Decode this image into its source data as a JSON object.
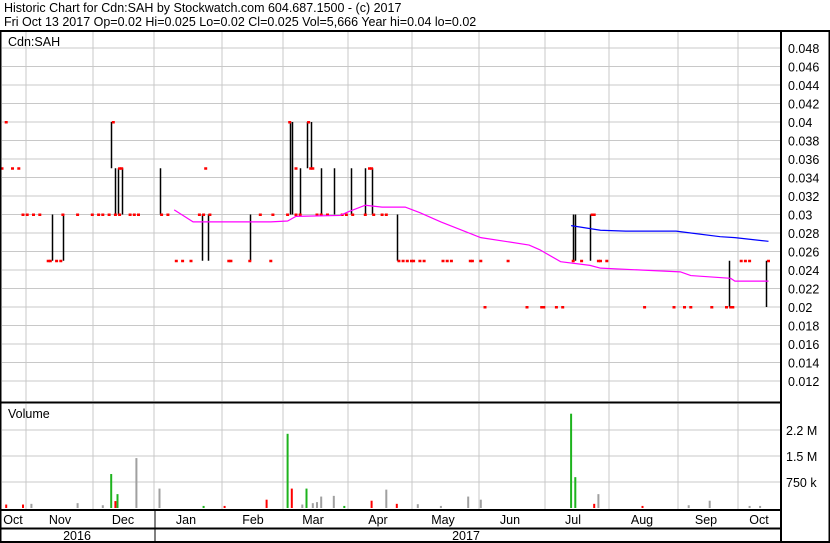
{
  "header": {
    "title": "Historic Chart for Cdn:SAH by Stockwatch.com 604.687.1500 - (c) 2017",
    "quote": "Fri Oct 13 2017  Op=0.02  Hi=0.025  Lo=0.02  Cl=0.025  Vol=5,666  Year hi=0.04  lo=0.02"
  },
  "colors": {
    "up": "#1db31d",
    "down": "#ff0000",
    "neutral": "#a0a0a0",
    "ma_short": "#ff00ff",
    "ma_long": "#0000ff",
    "tick": "#ff0000",
    "bar": "#000000"
  },
  "chart_data": {
    "type": "ohlc",
    "title": "Cdn:SAH",
    "x_unit": "days since 2016-10-20",
    "xlim": [
      0,
      370
    ],
    "ylim": [
      0.0101,
      0.0497
    ],
    "grid": true,
    "y_ticks": [
      "0.048",
      "0.046",
      "0.044",
      "0.042",
      "0.04",
      "0.038",
      "0.036",
      "0.034",
      "0.032",
      "0.03",
      "0.028",
      "0.026",
      "0.024",
      "0.022",
      "0.02",
      "0.018",
      "0.016",
      "0.014",
      "0.012"
    ],
    "month_labels": [
      "Oct",
      "Nov",
      "Dec",
      "Jan",
      "Feb",
      "Mar",
      "Apr",
      "May",
      "Jun",
      "Jul",
      "Aug",
      "Sep",
      "Oct"
    ],
    "year_labels": [
      "2016",
      "2017"
    ],
    "price_bars": [
      [
        24,
        0.025,
        0.03
      ],
      [
        29,
        0.025,
        0.03
      ],
      [
        52,
        0.035,
        0.04
      ],
      [
        54,
        0.03,
        0.035
      ],
      [
        55,
        0.03,
        0.035
      ],
      [
        57,
        0.03,
        0.035
      ],
      [
        75,
        0.03,
        0.035
      ],
      [
        95,
        0.025,
        0.03
      ],
      [
        98,
        0.025,
        0.03
      ],
      [
        118,
        0.025,
        0.03
      ],
      [
        137,
        0.03,
        0.04
      ],
      [
        138,
        0.03,
        0.04
      ],
      [
        142,
        0.03,
        0.035
      ],
      [
        145,
        0.035,
        0.04
      ],
      [
        147,
        0.035,
        0.04
      ],
      [
        152,
        0.03,
        0.035
      ],
      [
        158,
        0.03,
        0.035
      ],
      [
        166,
        0.03,
        0.035
      ],
      [
        173,
        0.03,
        0.035
      ],
      [
        176,
        0.03,
        0.035
      ],
      [
        188,
        0.025,
        0.03
      ],
      [
        272,
        0.025,
        0.03
      ],
      [
        273,
        0.025,
        0.03
      ],
      [
        280,
        0.025,
        0.03
      ],
      [
        346,
        0.02,
        0.025
      ],
      [
        364,
        0.02,
        0.025
      ]
    ],
    "close_ticks": [
      [
        2,
        0.04
      ],
      [
        53,
        0.04
      ],
      [
        137,
        0.04
      ],
      [
        146,
        0.04
      ],
      [
        0,
        0.035
      ],
      [
        5,
        0.035
      ],
      [
        8,
        0.035
      ],
      [
        56,
        0.035
      ],
      [
        57,
        0.035
      ],
      [
        97,
        0.035
      ],
      [
        140,
        0.035
      ],
      [
        147,
        0.035
      ],
      [
        148,
        0.035
      ],
      [
        175,
        0.035
      ],
      [
        176,
        0.035
      ],
      [
        10,
        0.03
      ],
      [
        12,
        0.03
      ],
      [
        15,
        0.03
      ],
      [
        18,
        0.03
      ],
      [
        29,
        0.03
      ],
      [
        36,
        0.03
      ],
      [
        43,
        0.03
      ],
      [
        46,
        0.03
      ],
      [
        48,
        0.03
      ],
      [
        51,
        0.03
      ],
      [
        54,
        0.03
      ],
      [
        56,
        0.03
      ],
      [
        61,
        0.03
      ],
      [
        63,
        0.03
      ],
      [
        65,
        0.03
      ],
      [
        76,
        0.03
      ],
      [
        79,
        0.03
      ],
      [
        94,
        0.03
      ],
      [
        96,
        0.03
      ],
      [
        99,
        0.03
      ],
      [
        123,
        0.03
      ],
      [
        129,
        0.03
      ],
      [
        136,
        0.03
      ],
      [
        140,
        0.03
      ],
      [
        142,
        0.03
      ],
      [
        150,
        0.03
      ],
      [
        152,
        0.03
      ],
      [
        155,
        0.03
      ],
      [
        162,
        0.03
      ],
      [
        164,
        0.03
      ],
      [
        167,
        0.03
      ],
      [
        173,
        0.03
      ],
      [
        177,
        0.03
      ],
      [
        181,
        0.03
      ],
      [
        183,
        0.03
      ],
      [
        281,
        0.03
      ],
      [
        282,
        0.03
      ],
      [
        22,
        0.025
      ],
      [
        23,
        0.025
      ],
      [
        26,
        0.025
      ],
      [
        28,
        0.025
      ],
      [
        83,
        0.025
      ],
      [
        86,
        0.025
      ],
      [
        90,
        0.025
      ],
      [
        108,
        0.025
      ],
      [
        109,
        0.025
      ],
      [
        118,
        0.025
      ],
      [
        128,
        0.025
      ],
      [
        189,
        0.025
      ],
      [
        191,
        0.025
      ],
      [
        193,
        0.025
      ],
      [
        195,
        0.025
      ],
      [
        196,
        0.025
      ],
      [
        199,
        0.025
      ],
      [
        201,
        0.025
      ],
      [
        210,
        0.025
      ],
      [
        212,
        0.025
      ],
      [
        214,
        0.025
      ],
      [
        223,
        0.025
      ],
      [
        224,
        0.025
      ],
      [
        228,
        0.025
      ],
      [
        241,
        0.025
      ],
      [
        272,
        0.025
      ],
      [
        276,
        0.025
      ],
      [
        284,
        0.025
      ],
      [
        285,
        0.025
      ],
      [
        288,
        0.025
      ],
      [
        352,
        0.025
      ],
      [
        354,
        0.025
      ],
      [
        356,
        0.025
      ],
      [
        365,
        0.025
      ],
      [
        230,
        0.02
      ],
      [
        250,
        0.02
      ],
      [
        257,
        0.02
      ],
      [
        258,
        0.02
      ],
      [
        264,
        0.02
      ],
      [
        267,
        0.02
      ],
      [
        306,
        0.02
      ],
      [
        320,
        0.02
      ],
      [
        325,
        0.02
      ],
      [
        328,
        0.02
      ],
      [
        338,
        0.02
      ],
      [
        345,
        0.02
      ],
      [
        347,
        0.02
      ],
      [
        348,
        0.02
      ]
    ],
    "series": [
      {
        "name": "short moving average",
        "color": "#ff00ff",
        "points": [
          [
            82,
            0.0305
          ],
          [
            91,
            0.0292
          ],
          [
            128,
            0.0292
          ],
          [
            136,
            0.0293
          ],
          [
            140,
            0.0298
          ],
          [
            161,
            0.0299
          ],
          [
            165,
            0.0303
          ],
          [
            173,
            0.031
          ],
          [
            181,
            0.0308
          ],
          [
            192,
            0.0308
          ],
          [
            199,
            0.0302
          ],
          [
            209,
            0.0292
          ],
          [
            228,
            0.0275
          ],
          [
            251,
            0.0267
          ],
          [
            256,
            0.0262
          ],
          [
            266,
            0.0249
          ],
          [
            280,
            0.0245
          ],
          [
            285,
            0.0242
          ],
          [
            304,
            0.024
          ],
          [
            323,
            0.0238
          ],
          [
            328,
            0.0234
          ],
          [
            347,
            0.0231
          ],
          [
            349,
            0.0228
          ],
          [
            365,
            0.0228
          ]
        ]
      },
      {
        "name": "long moving average",
        "color": "#0000ff",
        "points": [
          [
            271,
            0.0288
          ],
          [
            285,
            0.0283
          ],
          [
            297,
            0.0282
          ],
          [
            321,
            0.0282
          ],
          [
            328,
            0.028
          ],
          [
            342,
            0.0276
          ],
          [
            349,
            0.0275
          ],
          [
            365,
            0.0271
          ]
        ]
      }
    ],
    "volume": {
      "label": "Volume",
      "y_ticks": [
        {
          "label": "2.2 M",
          "value": 2250000
        },
        {
          "label": "1.5 M",
          "value": 1500000
        },
        {
          "label": "750 k",
          "value": 750000
        }
      ],
      "bars": [
        [
          2,
          100000,
          "down"
        ],
        [
          10,
          100000,
          "down"
        ],
        [
          14,
          120000,
          "neutral"
        ],
        [
          36,
          140000,
          "neutral"
        ],
        [
          48,
          80000,
          "neutral"
        ],
        [
          52,
          980000,
          "up"
        ],
        [
          54,
          200000,
          "down"
        ],
        [
          55,
          400000,
          "up"
        ],
        [
          64,
          1440000,
          "neutral"
        ],
        [
          75,
          560000,
          "neutral"
        ],
        [
          96,
          60000,
          "up"
        ],
        [
          106,
          60000,
          "down"
        ],
        [
          126,
          240000,
          "down"
        ],
        [
          136,
          2140000,
          "up"
        ],
        [
          138,
          560000,
          "down"
        ],
        [
          143,
          100000,
          "neutral"
        ],
        [
          145,
          560000,
          "up"
        ],
        [
          148,
          140000,
          "neutral"
        ],
        [
          150,
          170000,
          "neutral"
        ],
        [
          152,
          330000,
          "neutral"
        ],
        [
          158,
          350000,
          "neutral"
        ],
        [
          163,
          60000,
          "up"
        ],
        [
          176,
          210000,
          "down"
        ],
        [
          183,
          530000,
          "neutral"
        ],
        [
          188,
          120000,
          "down"
        ],
        [
          198,
          110000,
          "neutral"
        ],
        [
          209,
          60000,
          "neutral"
        ],
        [
          222,
          330000,
          "neutral"
        ],
        [
          228,
          240000,
          "neutral"
        ],
        [
          271,
          2720000,
          "up"
        ],
        [
          273,
          890000,
          "up"
        ],
        [
          282,
          120000,
          "down"
        ],
        [
          284,
          400000,
          "neutral"
        ],
        [
          305,
          60000,
          "down"
        ],
        [
          327,
          80000,
          "neutral"
        ],
        [
          337,
          210000,
          "neutral"
        ],
        [
          356,
          60000,
          "neutral"
        ],
        [
          361,
          60000,
          "neutral"
        ]
      ]
    }
  }
}
